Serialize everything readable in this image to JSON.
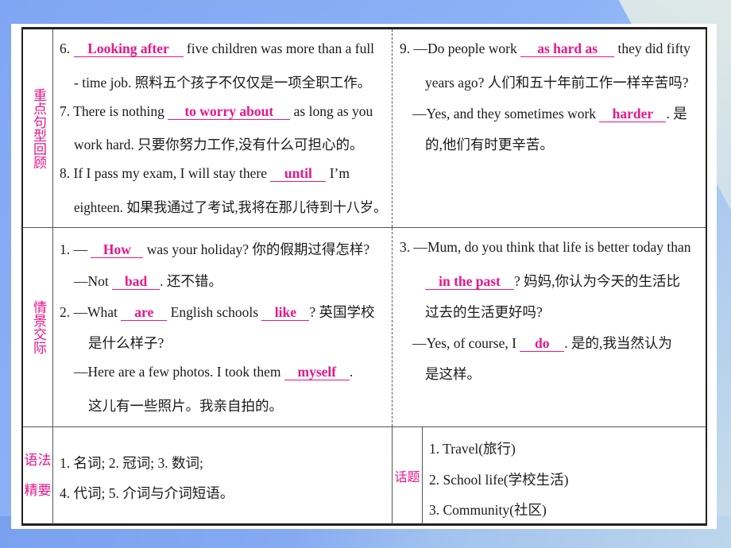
{
  "sections": {
    "key_sentences": {
      "label": "重点句型回顾",
      "left": {
        "q6": {
          "num": "6.",
          "answer": "Looking after",
          "after": "five children was more than a full",
          "line2": "- time job. 照料五个孩子不仅仅是一项全职工作。"
        },
        "q7": {
          "before": "7. There is nothing",
          "answer": "to worry about",
          "after": "as long as you",
          "line2": "work hard. 只要你努力工作,没有什么可担心的。"
        },
        "q8": {
          "before": "8. If I pass my exam, I will stay there",
          "answer": "until",
          "after": "I’m",
          "line2": "eighteen. 如果我通过了考试,我将在那儿待到十八岁。"
        }
      },
      "right": {
        "q9": {
          "before": "9. —Do people work",
          "answer": "as hard as",
          "after": "they did fifty",
          "line2": "years ago? 人们和五十年前工作一样辛苦吗?",
          "reply_before": "—Yes, and they sometimes work",
          "reply_answer": "harder",
          "reply_after": ". 是",
          "line4": "的,他们有时更辛苦。"
        }
      }
    },
    "situational": {
      "label": "情景交际",
      "left": {
        "q1": {
          "before": "1. —",
          "answer": "How",
          "after": "was your holiday? 你的假期过得怎样?",
          "reply_before": "—Not",
          "reply_answer": "bad",
          "reply_after": ". 还不错。"
        },
        "q2": {
          "before": "2. —What",
          "answer1": "are",
          "middle": "English schools",
          "answer2": "like",
          "after": "? 英国学校",
          "line2": "是什么样子?",
          "reply_before": "—Here are a few photos. I took them",
          "reply_answer": "myself",
          "reply_after": ".",
          "line4": "这儿有一些照片。我亲自拍的。"
        }
      },
      "right": {
        "q3": {
          "line1": "3. —Mum, do you think that life is better today than",
          "answer": "in the past",
          "after": "? 妈妈,你认为今天的生活比",
          "line3": "过去的生活更好吗?",
          "reply_before": "—Yes, of course, I",
          "reply_answer": "do",
          "reply_after": ". 是的,我当然认为",
          "line5": "是这样。"
        }
      }
    },
    "grammar": {
      "label_line1": "语法",
      "label_line2": "精要",
      "line1": "1. 名词;  2. 冠词;  3. 数词;",
      "line2": "4. 代词;  5. 介词与介词短语。"
    },
    "topics": {
      "label": "话题",
      "items": [
        "1. Travel(旅行)",
        "2. School life(学校生活)",
        "3. Community(社区)"
      ]
    }
  },
  "colors": {
    "accent": "#e8168a",
    "text": "#1a1a1a",
    "border": "#222222"
  }
}
